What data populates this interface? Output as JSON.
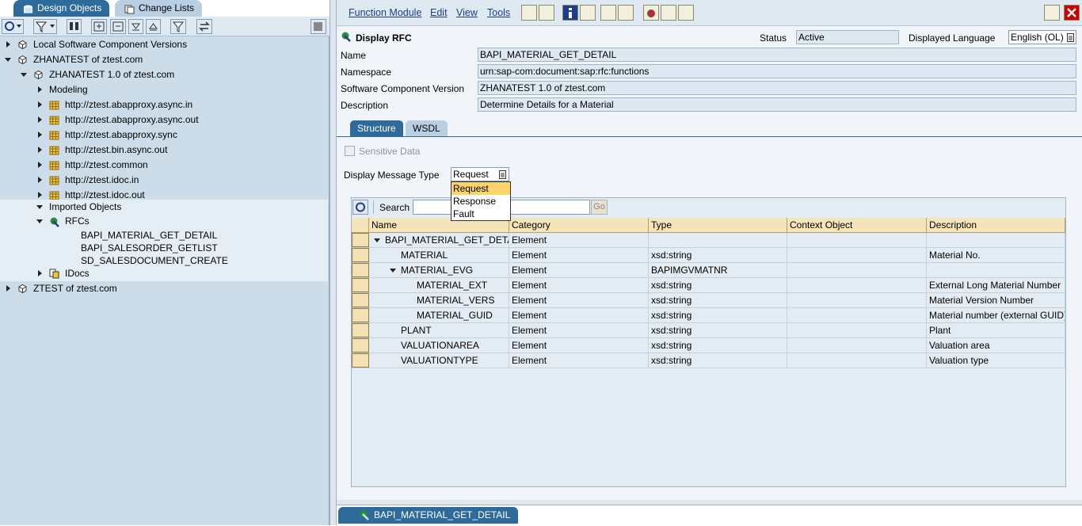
{
  "left": {
    "tabs": [
      "Design Objects",
      "Change Lists"
    ],
    "tree": [
      {
        "label": "Local Software Component Versions",
        "indent": 0,
        "arrow": "right",
        "icon": "swc-icon"
      },
      {
        "label": "ZHANATEST of ztest.com",
        "indent": 0,
        "arrow": "down",
        "icon": "swc-icon"
      },
      {
        "label": "ZHANATEST 1.0 of ztest.com",
        "indent": 1,
        "arrow": "down",
        "icon": "swcv-icon"
      },
      {
        "label": "Modeling",
        "indent": 2,
        "arrow": "right",
        "icon": ""
      },
      {
        "label": "http://ztest.abapproxy.async.in",
        "indent": 2,
        "arrow": "right",
        "icon": "namespace-icon"
      },
      {
        "label": "http://ztest.abapproxy.async.out",
        "indent": 2,
        "arrow": "right",
        "icon": "namespace-icon"
      },
      {
        "label": "http://ztest.abapproxy.sync",
        "indent": 2,
        "arrow": "right",
        "icon": "namespace-icon"
      },
      {
        "label": "http://ztest.bin.async.out",
        "indent": 2,
        "arrow": "right",
        "icon": "namespace-icon"
      },
      {
        "label": "http://ztest.common",
        "indent": 2,
        "arrow": "right",
        "icon": "namespace-icon"
      },
      {
        "label": "http://ztest.idoc.in",
        "indent": 2,
        "arrow": "right",
        "icon": "namespace-icon"
      },
      {
        "label": "http://ztest.idoc.out",
        "indent": 2,
        "arrow": "right",
        "icon": "namespace-icon"
      },
      {
        "label": "Imported Objects",
        "indent": 2,
        "arrow": "down",
        "icon": ""
      },
      {
        "label": "RFCs",
        "indent": 3,
        "arrow": "down",
        "icon": "rfc-icon"
      },
      {
        "label": "BAPI_MATERIAL_GET_DETAIL",
        "indent": 4,
        "arrow": "",
        "icon": ""
      },
      {
        "label": "BAPI_SALESORDER_GETLIST",
        "indent": 4,
        "arrow": "",
        "icon": ""
      },
      {
        "label": "SD_SALESDOCUMENT_CREATE",
        "indent": 4,
        "arrow": "",
        "icon": ""
      },
      {
        "label": "IDocs",
        "indent": 3,
        "arrow": "right",
        "icon": "idoc-icon"
      },
      {
        "label": "ZTEST of ztest.com",
        "indent": 0,
        "arrow": "right",
        "icon": "swc-icon"
      }
    ]
  },
  "menu": [
    "Function Module",
    "Edit",
    "View",
    "Tools"
  ],
  "header": {
    "title": "Display RFC",
    "status_label": "Status",
    "status_value": "Active",
    "language_label": "Displayed Language",
    "language_value": "English (OL)"
  },
  "fields": [
    {
      "label": "Name",
      "value": "BAPI_MATERIAL_GET_DETAIL"
    },
    {
      "label": "Namespace",
      "value": "urn:sap-com:document:sap:rfc:functions"
    },
    {
      "label": "Software Component Version",
      "value": "ZHANATEST 1.0 of ztest.com"
    },
    {
      "label": "Description",
      "value": "Determine Details for a Material"
    }
  ],
  "tabs": [
    "Structure",
    "WSDL"
  ],
  "sensitive_label": "Sensitive Data",
  "message_type": {
    "label": "Display Message Type",
    "value": "Request",
    "options": [
      "Request",
      "Response",
      "Fault"
    ]
  },
  "search": {
    "label": "Search",
    "go": "Go"
  },
  "table": {
    "columns": [
      "Name",
      "Category",
      "Type",
      "Context Object",
      "Description"
    ],
    "rows": [
      {
        "name": "BAPI_MATERIAL_GET_DETAIL",
        "level": 0,
        "arrow": "down",
        "category": "Element",
        "type": "",
        "context": "",
        "description": ""
      },
      {
        "name": "MATERIAL",
        "level": 1,
        "arrow": "",
        "category": "Element",
        "type": "xsd:string",
        "context": "",
        "description": "Material No."
      },
      {
        "name": "MATERIAL_EVG",
        "level": 1,
        "arrow": "down",
        "category": "Element",
        "type": "BAPIMGVMATNR",
        "context": "",
        "description": ""
      },
      {
        "name": "MATERIAL_EXT",
        "level": 2,
        "arrow": "",
        "category": "Element",
        "type": "xsd:string",
        "context": "",
        "description": "External Long Material Number"
      },
      {
        "name": "MATERIAL_VERS",
        "level": 2,
        "arrow": "",
        "category": "Element",
        "type": "xsd:string",
        "context": "",
        "description": "Material Version Number"
      },
      {
        "name": "MATERIAL_GUID",
        "level": 2,
        "arrow": "",
        "category": "Element",
        "type": "xsd:string",
        "context": "",
        "description": "Material number (external GUID)"
      },
      {
        "name": "PLANT",
        "level": 1,
        "arrow": "",
        "category": "Element",
        "type": "xsd:string",
        "context": "",
        "description": "Plant"
      },
      {
        "name": "VALUATIONAREA",
        "level": 1,
        "arrow": "",
        "category": "Element",
        "type": "xsd:string",
        "context": "",
        "description": "Valuation area"
      },
      {
        "name": "VALUATIONTYPE",
        "level": 1,
        "arrow": "",
        "category": "Element",
        "type": "xsd:string",
        "context": "",
        "description": "Valuation type"
      }
    ]
  },
  "bottom_tab": "BAPI_MATERIAL_GET_DETAIL"
}
